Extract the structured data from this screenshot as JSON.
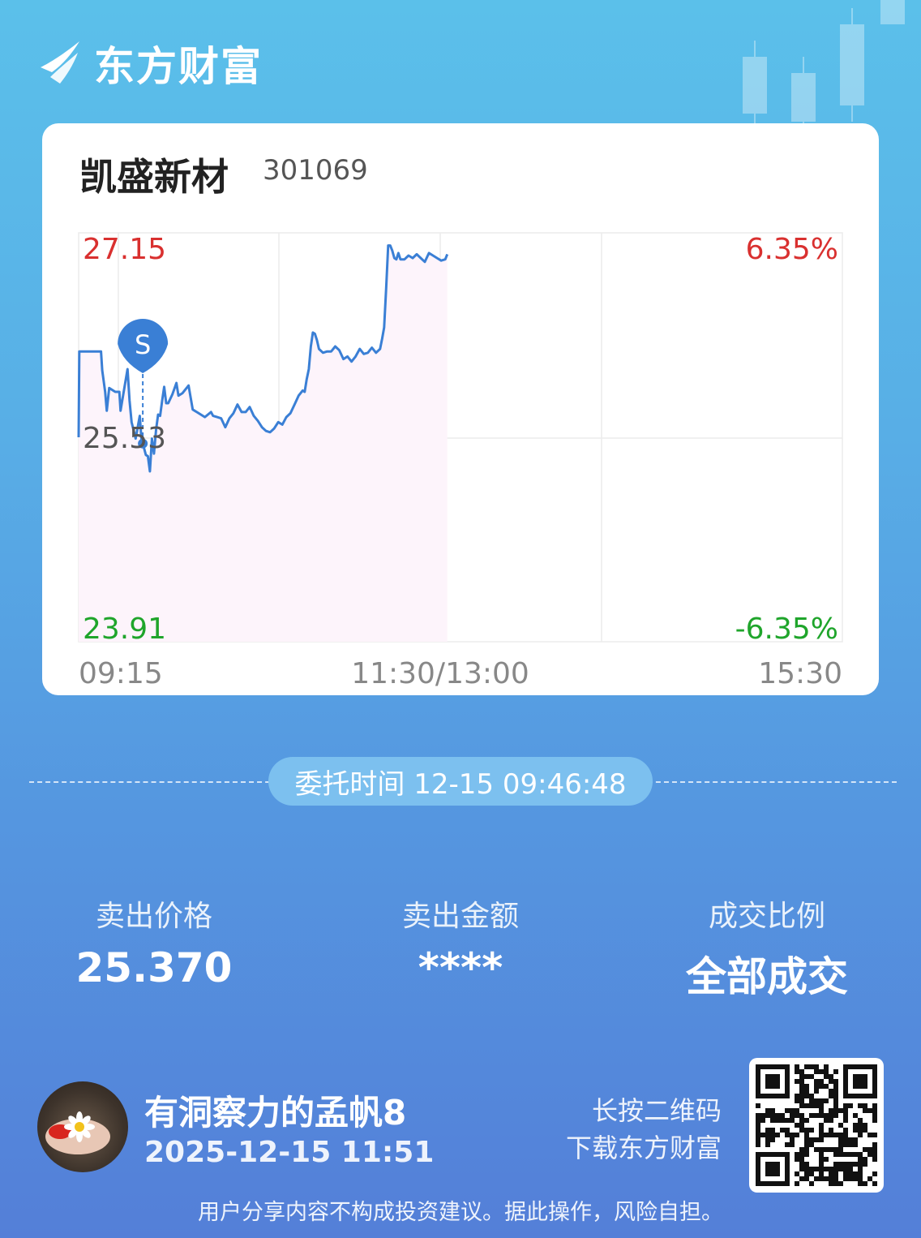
{
  "brand": {
    "name": "东方财富"
  },
  "stock": {
    "name": "凯盛新材",
    "code": "301069"
  },
  "chart_data": {
    "type": "line",
    "prev_close": 25.53,
    "y_max": 27.15,
    "y_min": 23.91,
    "y_max_pct": "6.35%",
    "y_min_pct": "-6.35%",
    "y_max_label": "27.15",
    "y_mid_label": "25.53",
    "y_min_label": "23.91",
    "x_tick_labels": [
      "09:15",
      "11:30/13:00",
      "15:30"
    ],
    "x_range_minutes": [
      0,
      375
    ],
    "line_color": "#3a7fd5",
    "up_color": "#d9302f",
    "down_color": "#1fa52b",
    "marker": {
      "label": "S",
      "minute": 31.5,
      "price": 25.48
    },
    "series": [
      {
        "points": [
          [
            0,
            25.53
          ],
          [
            0.3,
            26.21
          ],
          [
            4,
            26.21
          ],
          [
            8,
            26.21
          ],
          [
            11,
            26.21
          ],
          [
            11.6,
            26.06
          ],
          [
            13,
            25.89
          ],
          [
            13.8,
            25.74
          ],
          [
            15,
            25.92
          ],
          [
            18,
            25.89
          ],
          [
            20,
            25.89
          ],
          [
            20.6,
            25.74
          ],
          [
            22,
            25.88
          ],
          [
            24,
            26.07
          ],
          [
            25,
            25.82
          ],
          [
            26,
            25.65
          ],
          [
            28,
            25.52
          ],
          [
            30,
            25.7
          ],
          [
            31,
            25.48
          ],
          [
            32,
            25.45
          ],
          [
            33,
            25.39
          ],
          [
            34,
            25.38
          ],
          [
            35,
            25.26
          ],
          [
            36,
            25.52
          ],
          [
            37,
            25.4
          ],
          [
            38,
            25.59
          ],
          [
            39,
            25.71
          ],
          [
            40,
            25.7
          ],
          [
            41,
            25.82
          ],
          [
            42,
            25.93
          ],
          [
            43,
            25.8
          ],
          [
            44,
            25.8
          ],
          [
            46,
            25.87
          ],
          [
            48,
            25.96
          ],
          [
            49,
            25.86
          ],
          [
            51,
            25.88
          ],
          [
            52,
            25.9
          ],
          [
            54,
            25.94
          ],
          [
            56,
            25.75
          ],
          [
            58,
            25.73
          ],
          [
            62,
            25.69
          ],
          [
            65,
            25.73
          ],
          [
            66,
            25.7
          ],
          [
            68,
            25.69
          ],
          [
            70,
            25.68
          ],
          [
            72,
            25.61
          ],
          [
            74,
            25.68
          ],
          [
            76,
            25.72
          ],
          [
            78,
            25.79
          ],
          [
            80,
            25.73
          ],
          [
            82,
            25.73
          ],
          [
            84,
            25.77
          ],
          [
            86,
            25.7
          ],
          [
            88,
            25.66
          ],
          [
            90,
            25.61
          ],
          [
            92,
            25.58
          ],
          [
            94,
            25.57
          ],
          [
            96,
            25.6
          ],
          [
            98,
            25.65
          ],
          [
            100,
            25.63
          ],
          [
            102,
            25.69
          ],
          [
            104,
            25.72
          ],
          [
            106,
            25.79
          ],
          [
            108,
            25.86
          ],
          [
            110,
            25.9
          ],
          [
            111,
            25.89
          ],
          [
            112,
            25.99
          ],
          [
            113,
            26.07
          ],
          [
            114,
            26.25
          ],
          [
            115,
            26.36
          ],
          [
            116,
            26.35
          ],
          [
            117,
            26.3
          ],
          [
            118,
            26.23
          ],
          [
            120,
            26.2
          ],
          [
            122,
            26.21
          ],
          [
            124,
            26.21
          ],
          [
            126,
            26.25
          ],
          [
            128,
            26.22
          ],
          [
            130,
            26.15
          ],
          [
            132,
            26.17
          ],
          [
            134,
            26.13
          ],
          [
            136,
            26.17
          ],
          [
            138,
            26.23
          ],
          [
            140,
            26.19
          ],
          [
            142,
            26.2
          ],
          [
            144,
            26.24
          ],
          [
            146,
            26.2
          ],
          [
            148,
            26.23
          ],
          [
            149,
            26.31
          ],
          [
            150,
            26.4
          ],
          [
            151,
            26.71
          ],
          [
            152,
            27.05
          ],
          [
            153,
            27.05
          ],
          [
            154,
            27.01
          ],
          [
            155,
            26.95
          ],
          [
            156,
            26.94
          ],
          [
            157,
            26.99
          ],
          [
            158,
            26.94
          ],
          [
            160,
            26.94
          ],
          [
            162,
            26.97
          ],
          [
            164,
            26.95
          ],
          [
            166,
            26.98
          ],
          [
            168,
            26.95
          ],
          [
            170,
            26.92
          ],
          [
            172,
            26.99
          ],
          [
            174,
            26.97
          ],
          [
            176,
            26.95
          ],
          [
            178,
            26.93
          ],
          [
            180,
            26.94
          ],
          [
            181,
            26.98
          ]
        ]
      }
    ]
  },
  "order": {
    "time_label": "委托时间 12-15 09:46:48"
  },
  "stats": [
    {
      "label": "卖出价格",
      "value": "25.370"
    },
    {
      "label": "卖出金额",
      "value": "****"
    },
    {
      "label": "成交比例",
      "value": "全部成交"
    }
  ],
  "user": {
    "name": "有洞察力的孟帆8",
    "time": "2025-12-15 11:51"
  },
  "qr_hint": {
    "line1": "长按二维码",
    "line2": "下载东方财富"
  },
  "disclaimer": "用户分享内容不构成投资建议。据此操作，风险自担。"
}
